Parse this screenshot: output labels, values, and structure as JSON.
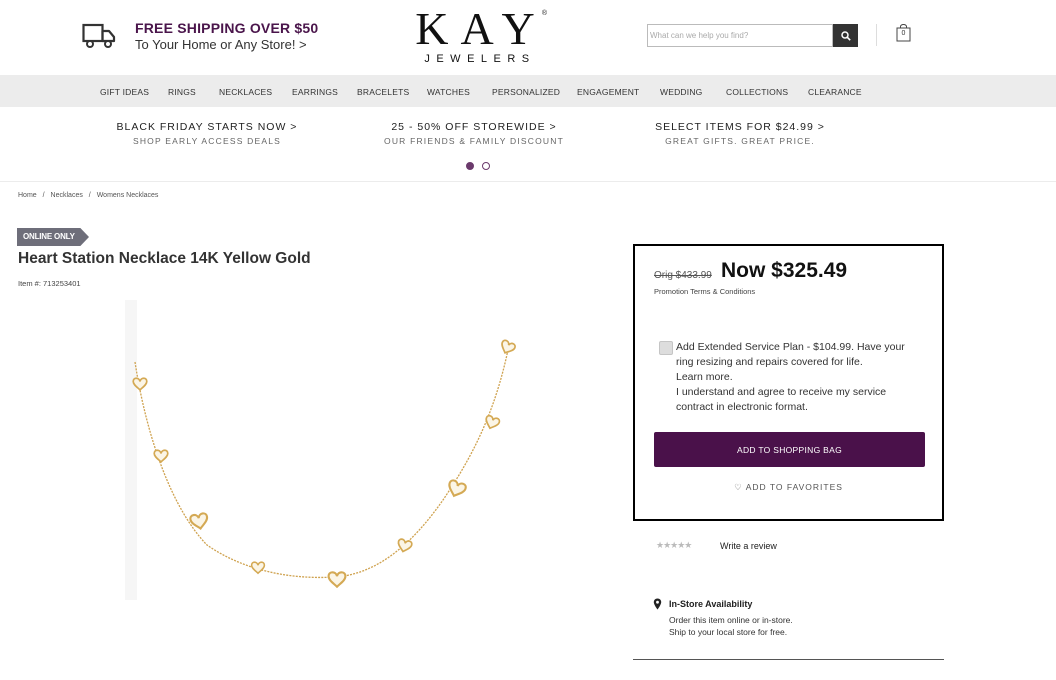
{
  "header": {
    "shipping_title": "FREE SHIPPING OVER $50",
    "shipping_sub": "To Your Home or Any Store! >",
    "logo_main": "KAY",
    "logo_sub": "JEWELERS",
    "logo_reg": "®",
    "search_placeholder": "What can we help you find?",
    "bag_count": "0",
    "icons": [
      "truck-icon",
      "search-icon",
      "shopping-bag-icon"
    ]
  },
  "nav": {
    "items": [
      {
        "label": "GIFT IDEAS"
      },
      {
        "label": "RINGS"
      },
      {
        "label": "NECKLACES"
      },
      {
        "label": "EARRINGS"
      },
      {
        "label": "BRACELETS"
      },
      {
        "label": "WATCHES"
      },
      {
        "label": "PERSONALIZED"
      },
      {
        "label": "ENGAGEMENT"
      },
      {
        "label": "WEDDING"
      },
      {
        "label": "COLLECTIONS"
      },
      {
        "label": "CLEARANCE"
      }
    ]
  },
  "promos": [
    {
      "title": "BLACK FRIDAY STARTS NOW >",
      "sub": "SHOP EARLY ACCESS DEALS"
    },
    {
      "title": "25 - 50% OFF STOREWIDE >",
      "sub": "OUR FRIENDS & FAMILY DISCOUNT"
    },
    {
      "title": "SELECT ITEMS FOR $24.99 >",
      "sub": "GREAT GIFTS. GREAT PRICE."
    }
  ],
  "carousel": {
    "active_index": 0,
    "count": 2
  },
  "breadcrumb": [
    {
      "label": "Home"
    },
    {
      "label": "/"
    },
    {
      "label": "Necklaces"
    },
    {
      "label": "/"
    },
    {
      "label": "Womens Necklaces"
    }
  ],
  "product": {
    "badge": "ONLINE ONLY",
    "title": "Heart Station Necklace 14K Yellow Gold",
    "item_number": "Item #: 713253401"
  },
  "buybox": {
    "orig_price": "Orig $433.99",
    "now_price": "Now $325.49",
    "promo_terms": "Promotion Terms & Conditions",
    "esp_line1": "Add Extended Service Plan -  $104.99. Have your ring resizing and repairs covered for life.",
    "esp_learn": "Learn more.",
    "esp_line2": "I understand and agree to receive my service contract in electronic format.",
    "add_to_bag": "ADD TO SHOPPING BAG",
    "add_to_favorites": "ADD TO FAVORITES",
    "esp_checked": false
  },
  "reviews": {
    "stars": "★★★★★",
    "rating": 0,
    "write_review": "Write a review"
  },
  "availability": {
    "title": "In-Store Availability",
    "line1": "Order this item online or in-store.",
    "line2": "Ship to your local store for free."
  },
  "colors": {
    "brand_purple": "#4a114a",
    "nav_bg": "#ececec",
    "badge_gray": "#6e6e7a",
    "gold": "#d8b060"
  }
}
